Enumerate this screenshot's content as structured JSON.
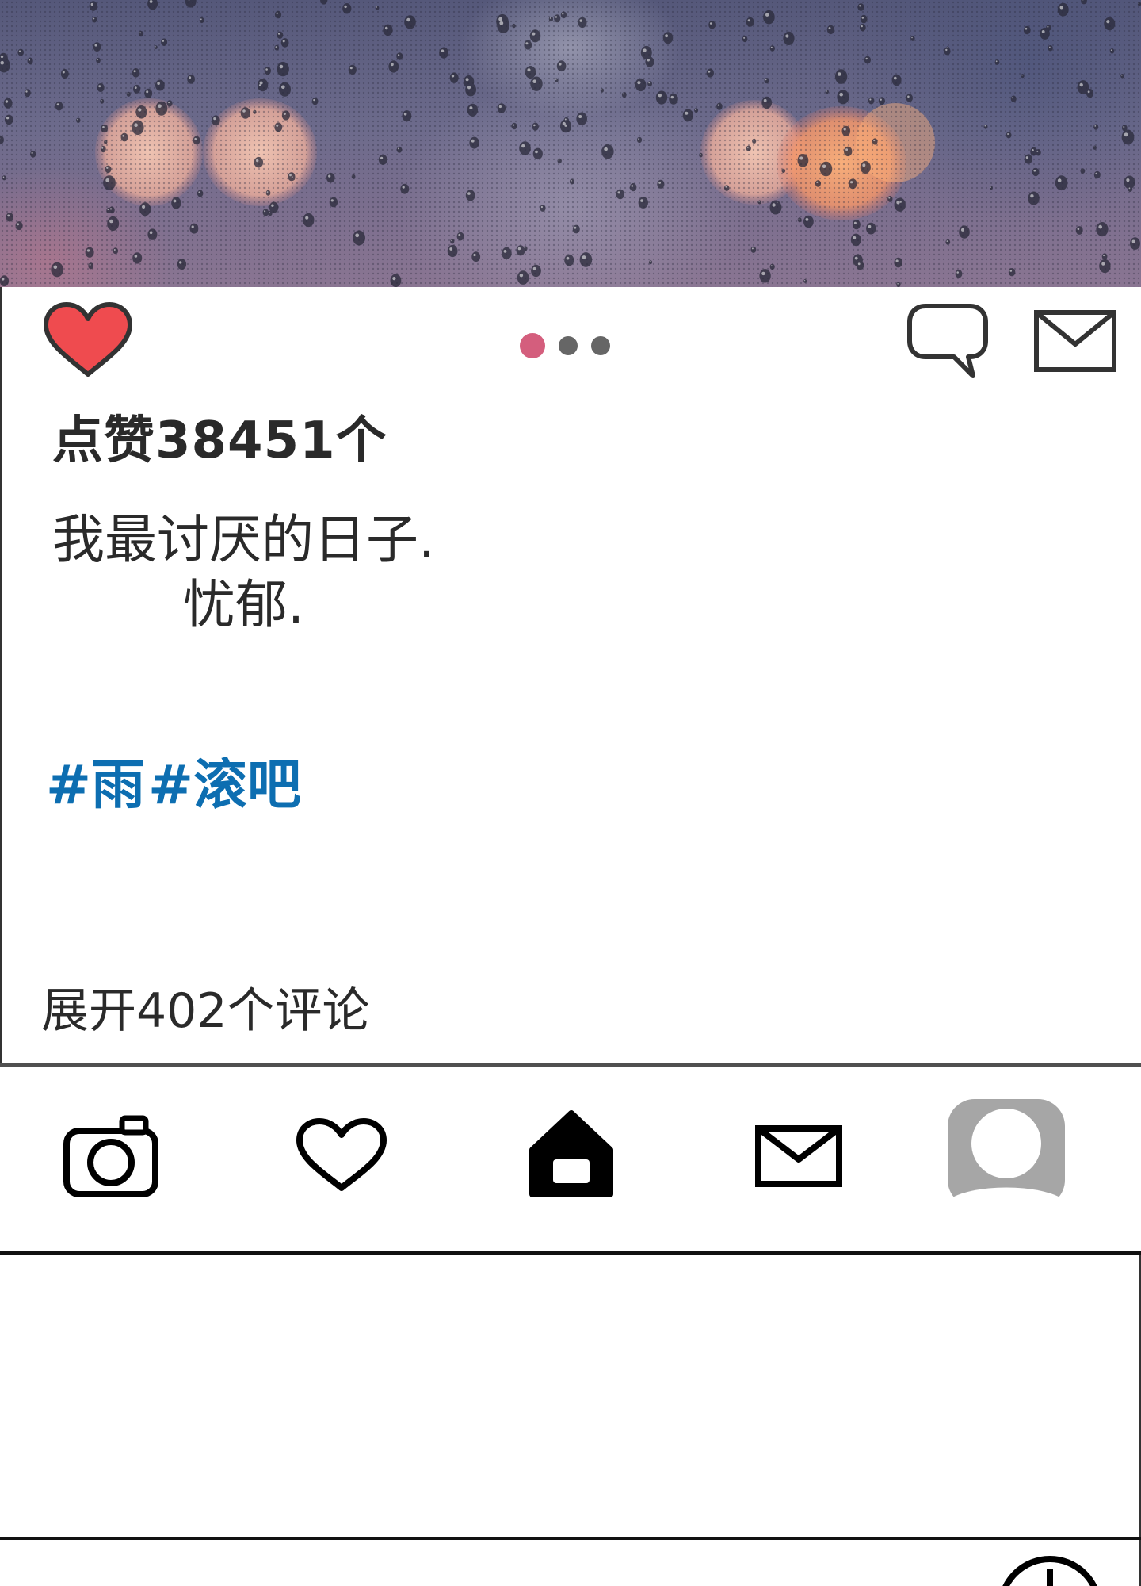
{
  "post": {
    "image_alt": "rain drops on window with bokeh lights",
    "likes_text": "点赞38451个",
    "caption_lines": [
      "我最讨厌的日子.",
      "忧郁."
    ],
    "hashtags": [
      "#雨",
      "#滚吧"
    ],
    "view_comments": "展开402个评论",
    "carousel": {
      "count": 3,
      "active_index": 0
    }
  },
  "colors": {
    "like_red": "#ef4b4f",
    "dot_active": "#d45e7d",
    "dot_inactive": "#666666",
    "hashtag_blue": "#0d6eb1",
    "profile_gray": "#a6a6a6"
  },
  "icons": {
    "like": "heart-filled-icon",
    "comment": "speech-bubble-icon",
    "send": "envelope-icon"
  },
  "bottom_nav": [
    {
      "name": "camera",
      "icon": "camera-icon"
    },
    {
      "name": "activity",
      "icon": "heart-outline-icon"
    },
    {
      "name": "home",
      "icon": "home-icon"
    },
    {
      "name": "inbox",
      "icon": "envelope-icon"
    },
    {
      "name": "profile",
      "icon": "profile-avatar-icon"
    }
  ]
}
